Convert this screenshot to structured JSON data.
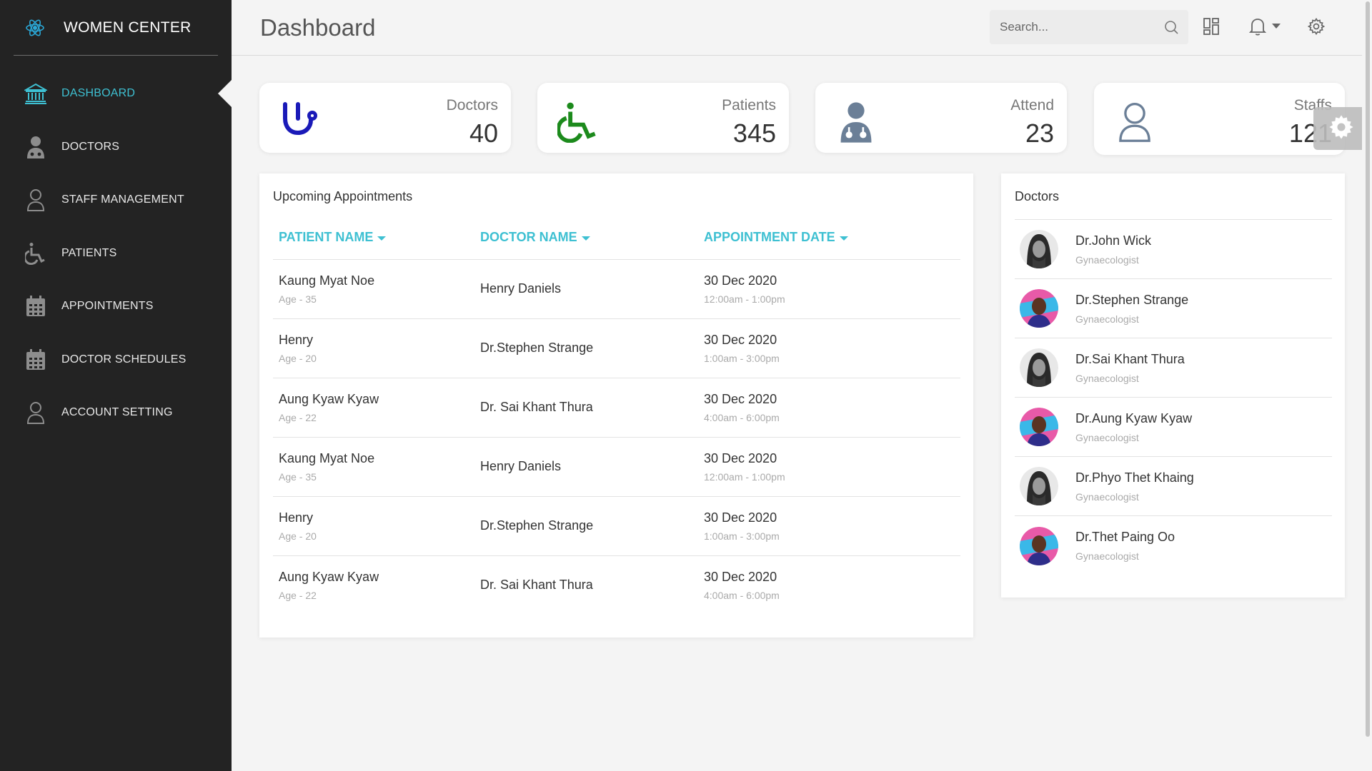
{
  "brand": {
    "title": "WOMEN CENTER",
    "icon": "atom-icon"
  },
  "sidebar": {
    "items": [
      {
        "label": "DASHBOARD",
        "icon": "bank-icon",
        "active": true
      },
      {
        "label": "DOCTORS",
        "icon": "doctor-icon"
      },
      {
        "label": "STAFF MANAGEMENT",
        "icon": "user-icon"
      },
      {
        "label": "PATIENTS",
        "icon": "wheelchair-icon"
      },
      {
        "label": "APPOINTMENTS",
        "icon": "calendar-icon"
      },
      {
        "label": "DOCTOR SCHEDULES",
        "icon": "calendar-icon"
      },
      {
        "label": "ACCOUNT SETTING",
        "icon": "user-icon"
      }
    ]
  },
  "header": {
    "title": "Dashboard",
    "search_placeholder": "Search...",
    "icons": [
      "search-icon",
      "grid-icon",
      "bell-icon",
      "gear-icon"
    ]
  },
  "stats": [
    {
      "label": "Doctors",
      "value": "40",
      "icon": "stethoscope-icon",
      "color": "#1a1ab8"
    },
    {
      "label": "Patients",
      "value": "345",
      "icon": "wheelchair-icon",
      "color": "#1c8a1c"
    },
    {
      "label": "Attend",
      "value": "23",
      "icon": "doctor-icon",
      "color": "#6b7f97"
    },
    {
      "label": "Staffs",
      "value": "121",
      "icon": "user-icon",
      "color": "#6b7f97"
    }
  ],
  "appointments": {
    "title": "Upcoming Appointments",
    "columns": [
      "PATIENT NAME",
      "DOCTOR NAME",
      "APPOINTMENT DATE"
    ],
    "rows": [
      {
        "patient": "Kaung Myat Noe",
        "age": "Age - 35",
        "doctor": "Henry Daniels",
        "date": "30 Dec 2020",
        "time": "12:00am - 1:00pm"
      },
      {
        "patient": "Henry",
        "age": "Age - 20",
        "doctor": "Dr.Stephen Strange",
        "date": "30 Dec 2020",
        "time": "1:00am - 3:00pm"
      },
      {
        "patient": "Aung Kyaw Kyaw",
        "age": "Age - 22",
        "doctor": "Dr. Sai Khant Thura",
        "date": "30 Dec 2020",
        "time": "4:00am - 6:00pm"
      },
      {
        "patient": "Kaung Myat Noe",
        "age": "Age - 35",
        "doctor": "Henry Daniels",
        "date": "30 Dec 2020",
        "time": "12:00am - 1:00pm"
      },
      {
        "patient": "Henry",
        "age": "Age - 20",
        "doctor": "Dr.Stephen Strange",
        "date": "30 Dec 2020",
        "time": "1:00am - 3:00pm"
      },
      {
        "patient": "Aung Kyaw Kyaw",
        "age": "Age - 22",
        "doctor": "Dr. Sai Khant Thura",
        "date": "30 Dec 2020",
        "time": "4:00am - 6:00pm"
      }
    ]
  },
  "doctors": {
    "title": "Doctors",
    "items": [
      {
        "name": "Dr.John Wick",
        "role": "Gynaecologist",
        "avatar": "bw"
      },
      {
        "name": "Dr.Stephen Strange",
        "role": "Gynaecologist",
        "avatar": "color"
      },
      {
        "name": "Dr.Sai Khant Thura",
        "role": "Gynaecologist",
        "avatar": "bw"
      },
      {
        "name": "Dr.Aung Kyaw Kyaw",
        "role": "Gynaecologist",
        "avatar": "color"
      },
      {
        "name": "Dr.Phyo Thet Khaing",
        "role": "Gynaecologist",
        "avatar": "bw"
      },
      {
        "name": "Dr.Thet Paing Oo",
        "role": "Gynaecologist",
        "avatar": "color"
      }
    ]
  },
  "colors": {
    "accent": "#3ec0d2",
    "sidebar": "#232323",
    "background": "#f4f4f4"
  }
}
